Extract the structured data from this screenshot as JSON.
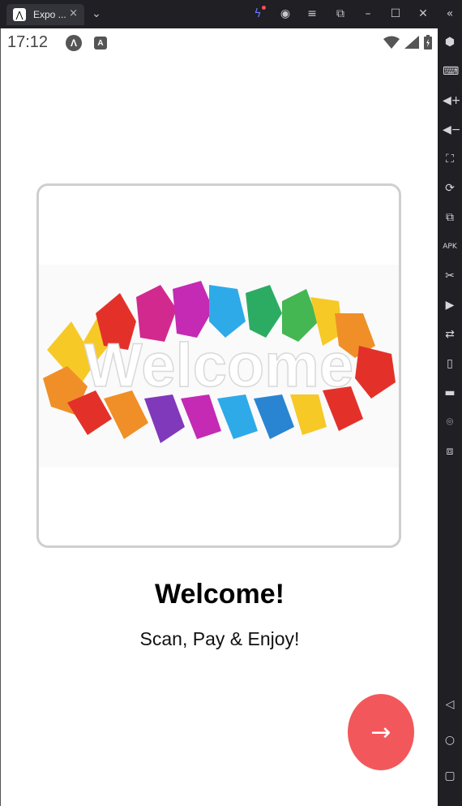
{
  "window": {
    "tab_title": "Expo ...",
    "tab_logo": "expo-logo",
    "tab_close": "×",
    "icons": [
      "chevron-down-icon",
      "bolt-icon",
      "account-icon",
      "menu-icon",
      "pip-icon",
      "minimize-icon",
      "maximize-icon",
      "close-icon",
      "collapse-sidebar-icon"
    ]
  },
  "statusbar": {
    "time": "17:12",
    "notification_badges": [
      "expo-go-icon",
      "accessibility-icon"
    ],
    "system_icons": [
      "wifi-icon",
      "signal-icon",
      "battery-icon"
    ]
  },
  "main": {
    "image_alt": "Welcome",
    "image_text": "Welcome",
    "heading": "Welcome!",
    "subtitle": "Scan, Pay & Enjoy!",
    "next_button": "→"
  },
  "emulator_toolbar": {
    "items": [
      "settings-icon",
      "keyboard-icon",
      "volume-up-icon",
      "volume-down-icon",
      "screenshot-icon",
      "rotate-icon",
      "multi-window-icon",
      "apk-install-icon",
      "cut-icon",
      "record-icon",
      "sync-icon",
      "shake-icon",
      "folder-icon",
      "location-icon",
      "layers-icon",
      "back-icon",
      "home-icon",
      "recents-icon"
    ]
  },
  "colors": {
    "accent": "#f2585b",
    "card_border": "#cfcfcf",
    "chrome": "#1f1f24"
  }
}
